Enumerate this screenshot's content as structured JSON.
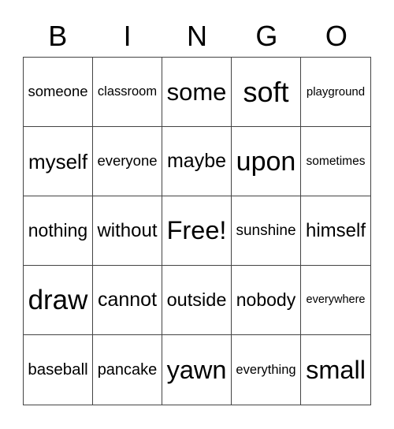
{
  "card": {
    "header": [
      "B",
      "I",
      "N",
      "G",
      "O"
    ],
    "rows": [
      [
        "someone",
        "classroom",
        "some",
        "soft",
        "playground"
      ],
      [
        "myself",
        "everyone",
        "maybe",
        "upon",
        "sometimes"
      ],
      [
        "nothing",
        "without",
        "Free!",
        "sunshine",
        "himself"
      ],
      [
        "draw",
        "cannot",
        "outside",
        "nobody",
        "everywhere"
      ],
      [
        "baseball",
        "pancake",
        "yawn",
        "everything",
        "small"
      ]
    ]
  }
}
